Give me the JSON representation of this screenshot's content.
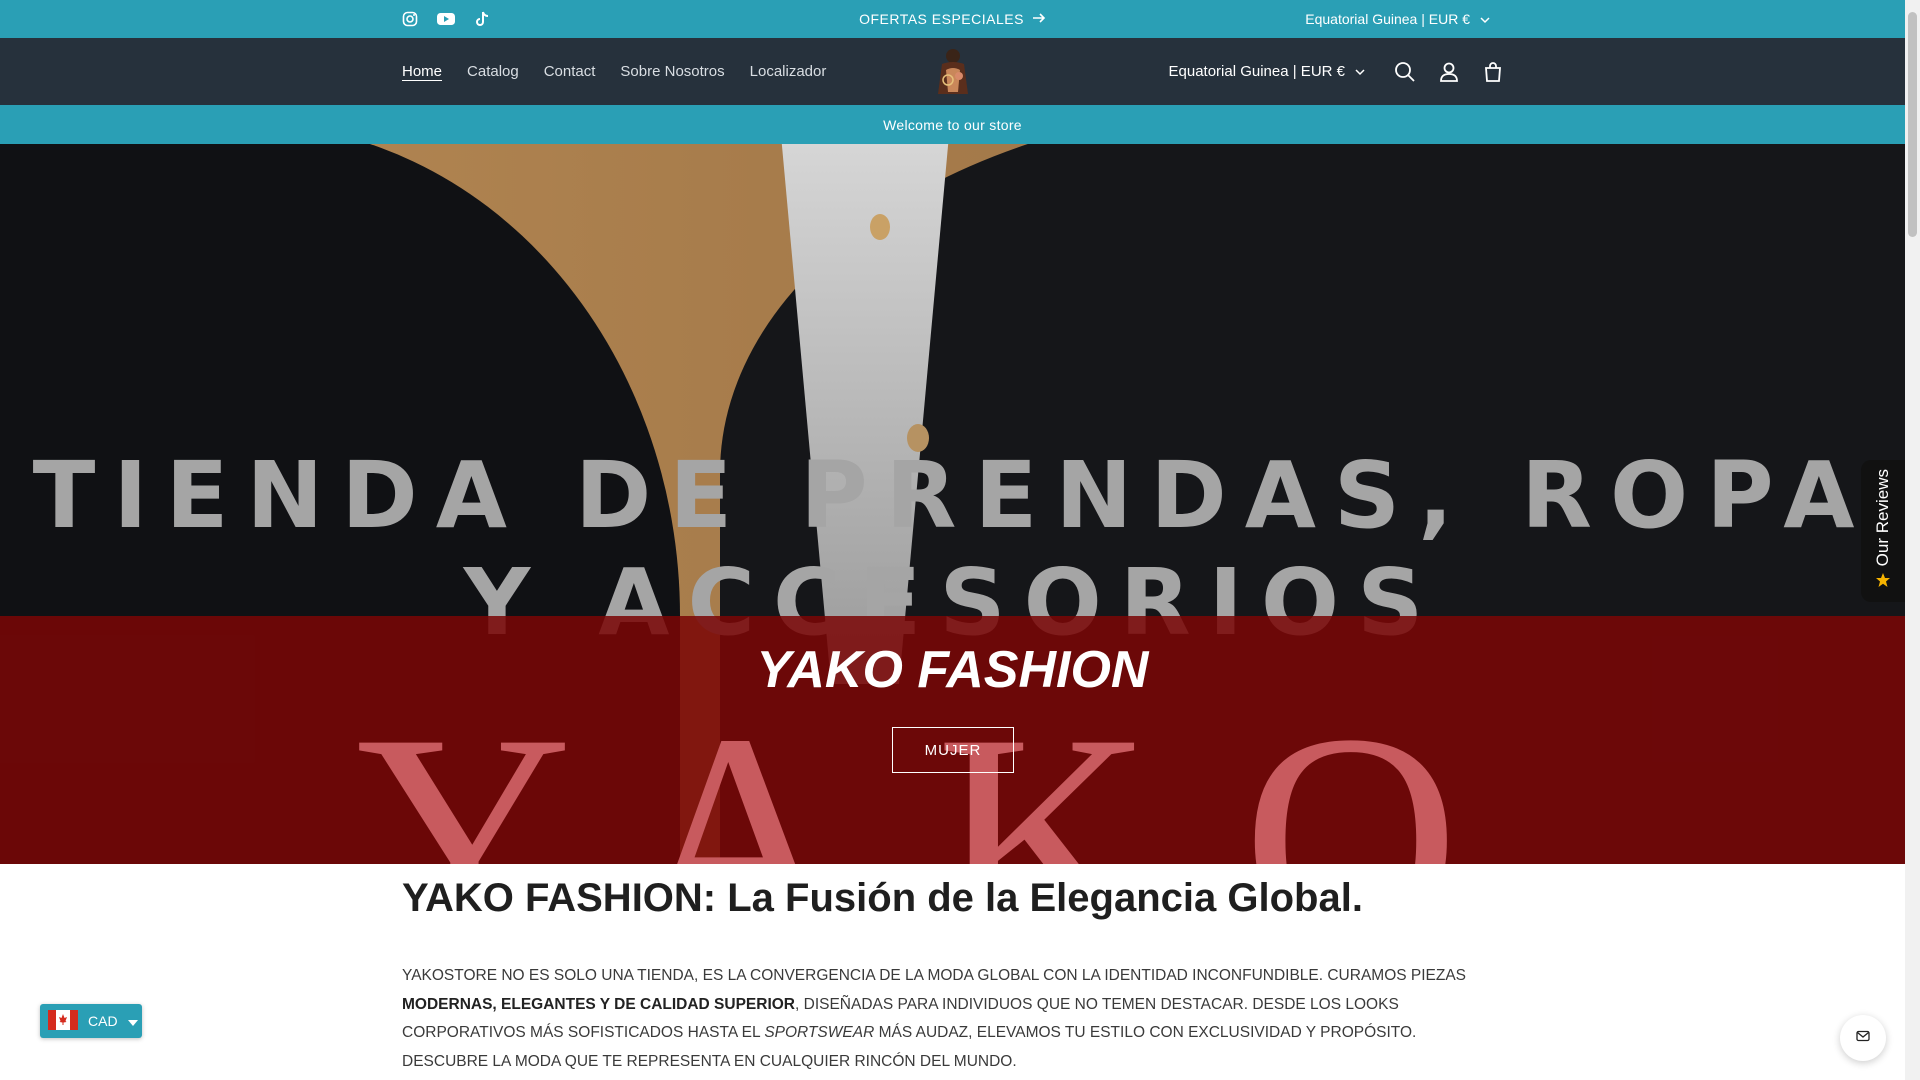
{
  "topbar": {
    "social_icons": [
      "instagram-icon",
      "youtube-icon",
      "tiktok-icon"
    ],
    "promo_label": "OFERTAS ESPECIALES",
    "country_selector": "Equatorial Guinea | EUR €"
  },
  "header": {
    "nav": [
      "Home",
      "Catalog",
      "Contact",
      "Sobre Nosotros",
      "Localizador"
    ],
    "country_selector": "Equatorial Guinea | EUR €",
    "icons": [
      "search-icon",
      "account-icon",
      "cart-icon"
    ]
  },
  "welcome_text": "Welcome to our store",
  "hero": {
    "headline": "TIENDA DE PRENDAS, ROPA Y ACCESORIOS",
    "big_word": "YAKO",
    "brand_title": "YAKO FASHION",
    "cta_label": "MUJER"
  },
  "content": {
    "title": "YAKO FASHION: La Fusión de la Elegancia Global.",
    "para_part1": "YAKOSTORE NO ES SOLO UNA TIENDA, ES LA CONVERGENCIA DE LA MODA GLOBAL CON LA IDENTIDAD INCONFUNDIBLE. CURAMOS PIEZAS ",
    "para_bold": "MODERNAS, ELEGANTES Y DE CALIDAD SUPERIOR",
    "para_part2": ", DISEÑADAS PARA INDIVIDUOS QUE NO TEMEN DESTACAR. DESDE LOS LOOKS CORPORATIVOS MÁS SOFISTICADOS HASTA EL ",
    "para_italic": "SPORTSWEAR",
    "para_part3": " MÁS AUDAZ, ELEVAMOS TU ESTILO CON EXCLUSIVIDAD Y PROPÓSITO. DESCUBRE LA MODA QUE TE REPRESENTA EN CUALQUIER RINCÓN DEL MUNDO."
  },
  "widgets": {
    "reviews_label": "Our Reviews",
    "currency_code": "CAD"
  },
  "colors": {
    "teal": "#2a9fb5",
    "header_dark": "#26313c",
    "hero_red": "#7a0606"
  }
}
